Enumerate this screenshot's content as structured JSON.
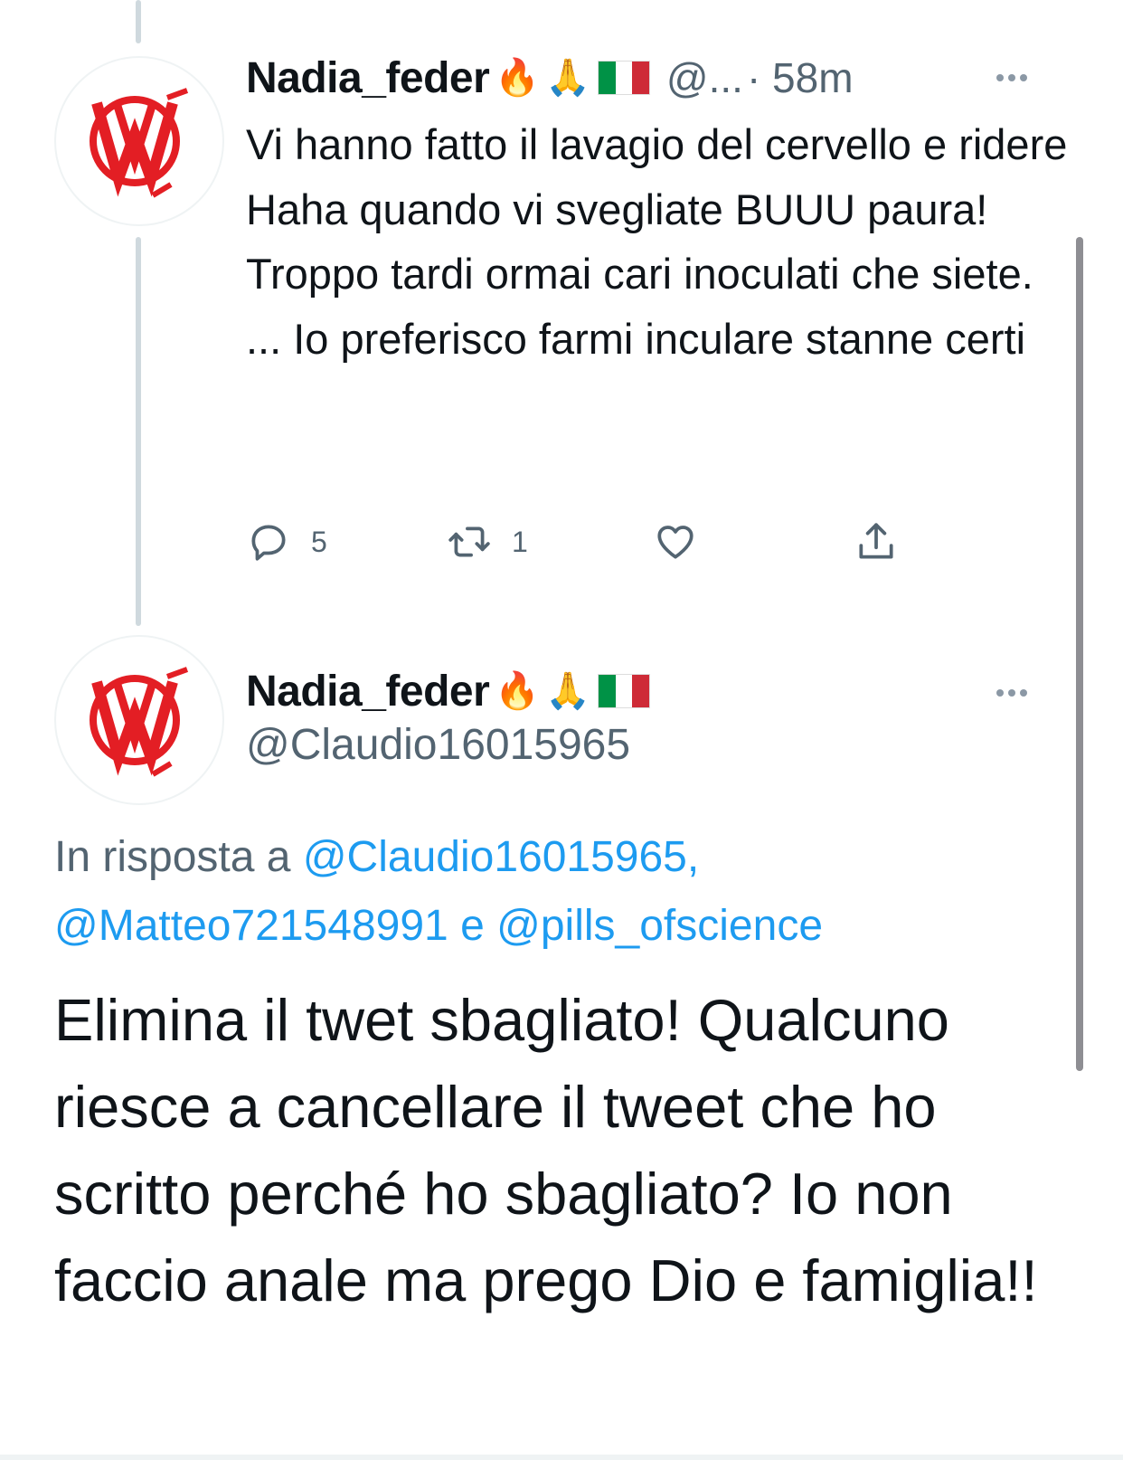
{
  "parent_tweet": {
    "author_name": "Nadia_feder",
    "emoji_fire": "🔥",
    "emoji_pray": "🙏",
    "handle_truncated": "@...",
    "time": "· 58m",
    "text": "Vi hanno fatto il lavagio del cervello e ridere Haha quando vi svegliate BUUU paura! Troppo tardi ormai cari inoculati che siete. ... Io preferisco farmi inculare stanne certi",
    "reply_count": "5",
    "retweet_count": "1",
    "like_count": "",
    "icons": {
      "reply": "reply-icon",
      "retweet": "retweet-icon",
      "like": "heart-icon",
      "share": "share-icon",
      "more": "more-icon"
    }
  },
  "focused_tweet": {
    "author_name": "Nadia_feder",
    "emoji_fire": "🔥",
    "emoji_pray": "🙏",
    "handle": "@Claudio16015965",
    "reply_prefix": "In risposta a",
    "mentions": [
      "@Claudio16015965,",
      "@Matteo721548991",
      "@pills_ofscience"
    ],
    "conjunction": "e",
    "text": "Elimina il twet sbagliato! Qualcuno riesce a cancellare il tweet che ho scritto perché ho sbagliato? Io non faccio anale ma prego Dio e famiglia!!"
  },
  "colors": {
    "link": "#1d9bf0",
    "secondary_text": "#536471",
    "avatar_logo": "#e31e24",
    "flag_green": "#009246",
    "flag_white": "#ffffff",
    "flag_red": "#ce2b37"
  }
}
